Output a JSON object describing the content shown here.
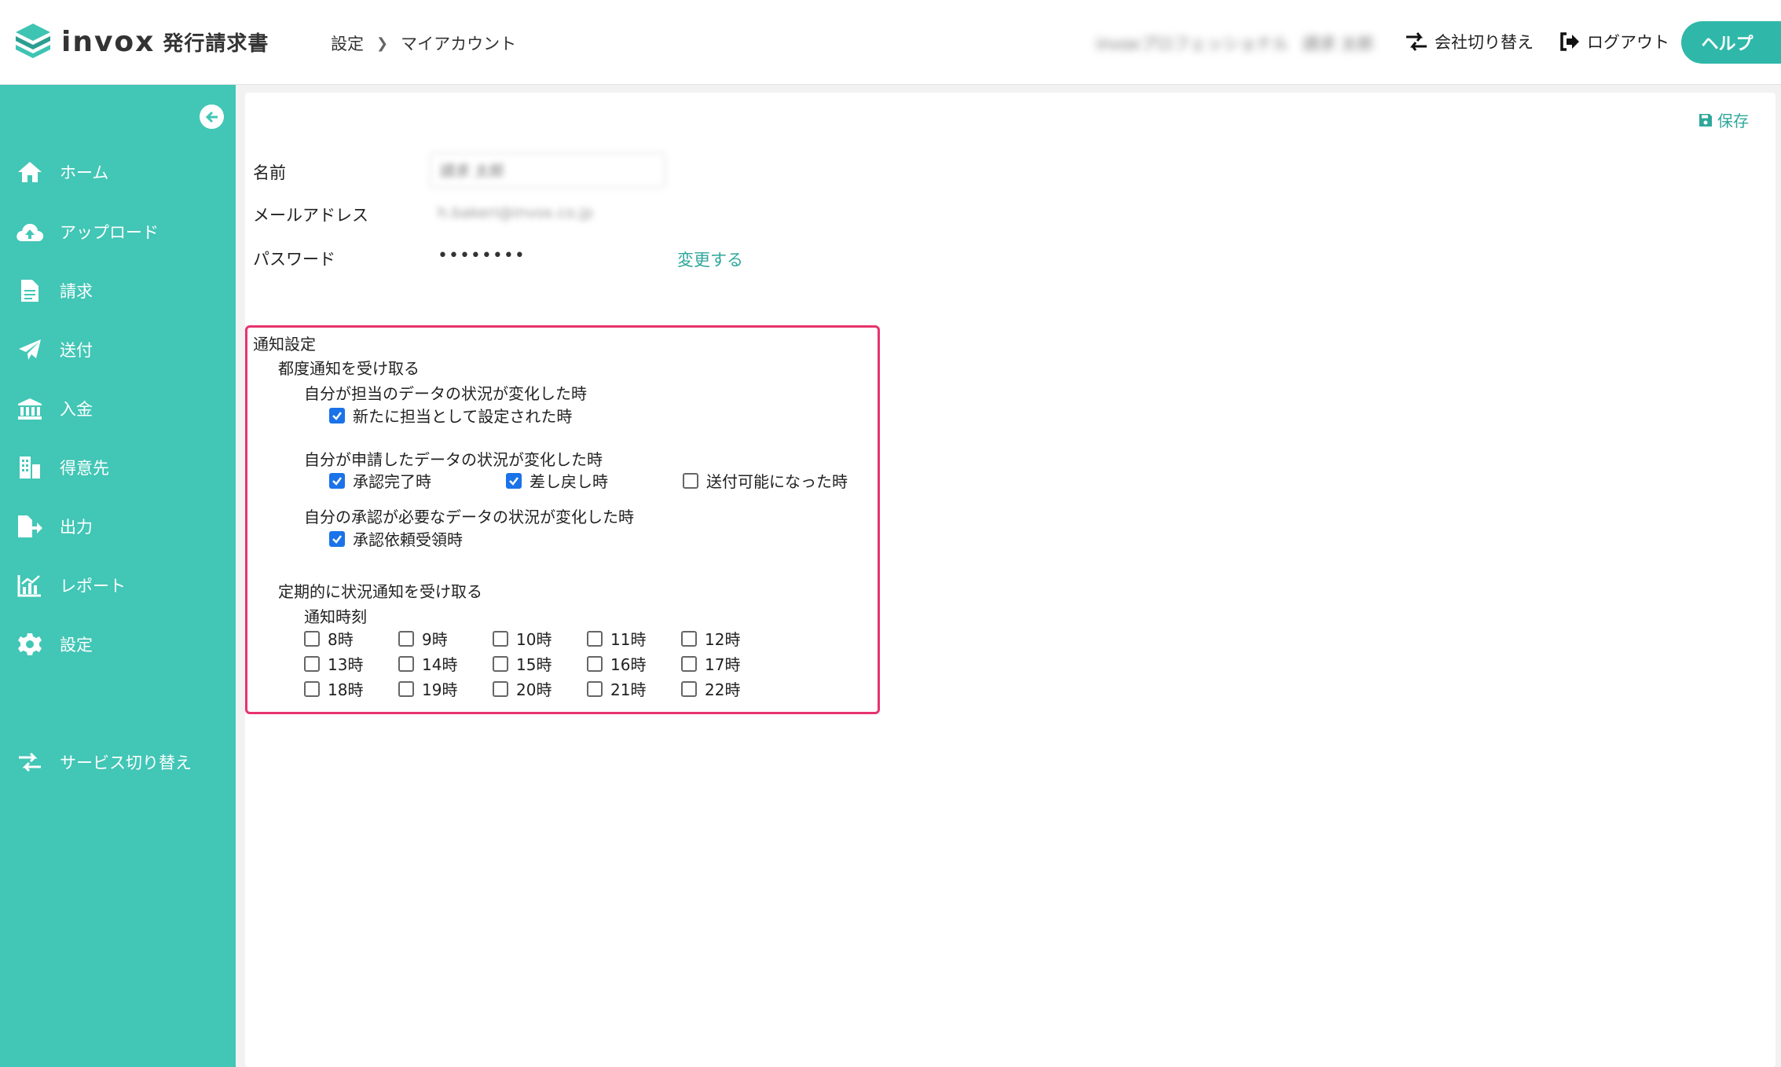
{
  "header": {
    "logo_word": "invox",
    "logo_sub": "発行請求書",
    "breadcrumb": [
      "設定",
      "マイアカウント"
    ],
    "company_blurred": "invoxプロフェッショナル",
    "user_blurred": "請求 太郎",
    "switch_company": "会社切り替え",
    "logout": "ログアウト",
    "help": "ヘルプ"
  },
  "sidebar": {
    "items": [
      {
        "label": "ホーム",
        "icon": "home-icon"
      },
      {
        "label": "アップロード",
        "icon": "cloud-upload-icon"
      },
      {
        "label": "請求",
        "icon": "document-icon"
      },
      {
        "label": "送付",
        "icon": "paper-plane-icon"
      },
      {
        "label": "入金",
        "icon": "bank-icon"
      },
      {
        "label": "得意先",
        "icon": "building-icon"
      },
      {
        "label": "出力",
        "icon": "file-export-icon"
      },
      {
        "label": "レポート",
        "icon": "chart-icon"
      },
      {
        "label": "設定",
        "icon": "gear-icon"
      }
    ],
    "service_switch": "サービス切り替え"
  },
  "account": {
    "save": "保存",
    "name_label": "名前",
    "name_value": "請求 太郎",
    "email_label": "メールアドレス",
    "email_value": "h.bakeri@invox.co.jp",
    "password_label": "パスワード",
    "password_value": "••••••••",
    "change_link": "変更する"
  },
  "notifications": {
    "title": "通知設定",
    "each_time": "都度通知を受け取る",
    "group1": {
      "heading": "自分が担当のデータの状況が変化した時",
      "options": [
        {
          "label": "新たに担当として設定された時",
          "checked": true
        }
      ]
    },
    "group2": {
      "heading": "自分が申請したデータの状況が変化した時",
      "options": [
        {
          "label": "承認完了時",
          "checked": true
        },
        {
          "label": "差し戻し時",
          "checked": true
        },
        {
          "label": "送付可能になった時",
          "checked": false
        }
      ]
    },
    "group3": {
      "heading": "自分の承認が必要なデータの状況が変化した時",
      "options": [
        {
          "label": "承認依頼受領時",
          "checked": true
        }
      ]
    },
    "periodic": "定期的に状況通知を受け取る",
    "time_heading": "通知時刻",
    "hours": [
      "8時",
      "9時",
      "10時",
      "11時",
      "12時",
      "13時",
      "14時",
      "15時",
      "16時",
      "17時",
      "18時",
      "19時",
      "20時",
      "21時",
      "22時"
    ],
    "accent_color": "#e8336d",
    "check_color": "#1a73e8"
  },
  "theme": {
    "sidebar_bg": "#42c6b6",
    "link_color": "#2fa79b"
  }
}
